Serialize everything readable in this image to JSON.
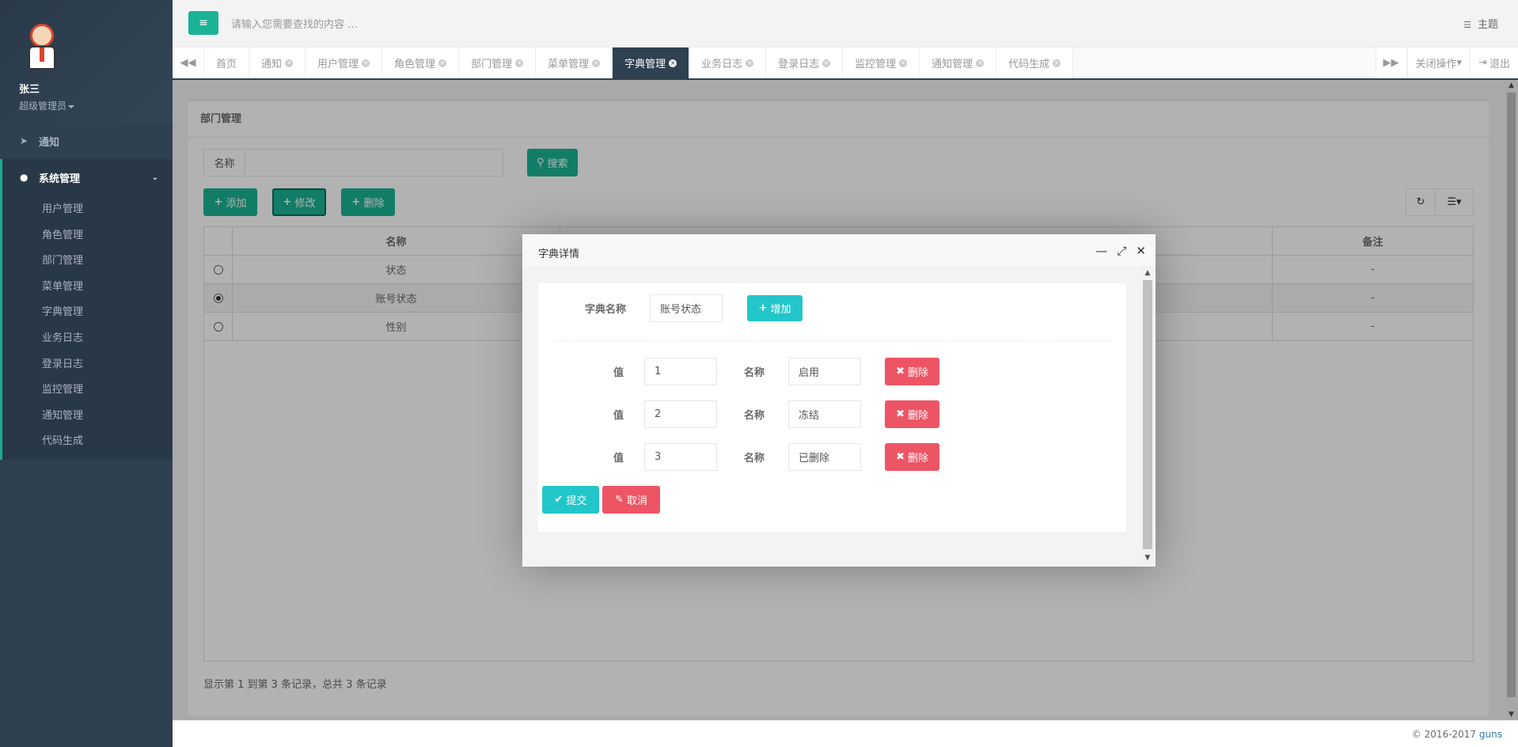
{
  "user": {
    "name": "张三",
    "role": "超级管理员"
  },
  "sidebar": {
    "notice": "通知",
    "system": "系统管理",
    "items": [
      "用户管理",
      "角色管理",
      "部门管理",
      "菜单管理",
      "字典管理",
      "业务日志",
      "登录日志",
      "监控管理",
      "通知管理",
      "代码生成"
    ]
  },
  "header": {
    "search_placeholder": "请输入您需要查找的内容 …",
    "theme": "主题"
  },
  "tabs": {
    "items": [
      "首页",
      "通知",
      "用户管理",
      "角色管理",
      "部门管理",
      "菜单管理",
      "字典管理",
      "业务日志",
      "登录日志",
      "监控管理",
      "通知管理",
      "代码生成"
    ],
    "active": "字典管理",
    "close_ops": "关闭操作",
    "logout": "退出"
  },
  "page": {
    "title": "部门管理",
    "search_label": "名称",
    "search_button": "搜索",
    "add": "添加",
    "edit": "修改",
    "delete": "删除",
    "columns": [
      "名称",
      "备注"
    ],
    "rows": [
      {
        "name": "状态",
        "note": "-",
        "selected": false
      },
      {
        "name": "账号状态",
        "note": "-",
        "selected": true
      },
      {
        "name": "性别",
        "note": "-",
        "selected": false
      }
    ],
    "pager": "显示第 1 到第 3 条记录，总共 3 条记录"
  },
  "dialog": {
    "title": "字典详情",
    "dict_label": "字典名称",
    "dict_value": "账号状态",
    "add_button": "增加",
    "value_label": "值",
    "name_label": "名称",
    "delete_button": "删除",
    "entries": [
      {
        "value": "1",
        "name": "启用"
      },
      {
        "value": "2",
        "name": "冻结"
      },
      {
        "value": "3",
        "name": "已删除"
      }
    ],
    "submit": "提交",
    "cancel": "取消"
  },
  "footer": {
    "copyright": "© 2016-2017",
    "brand": "guns"
  },
  "colors": {
    "sidebar": "#2f4050",
    "primary": "#1ab394",
    "info": "#23c6c8",
    "danger": "#ed5565"
  }
}
